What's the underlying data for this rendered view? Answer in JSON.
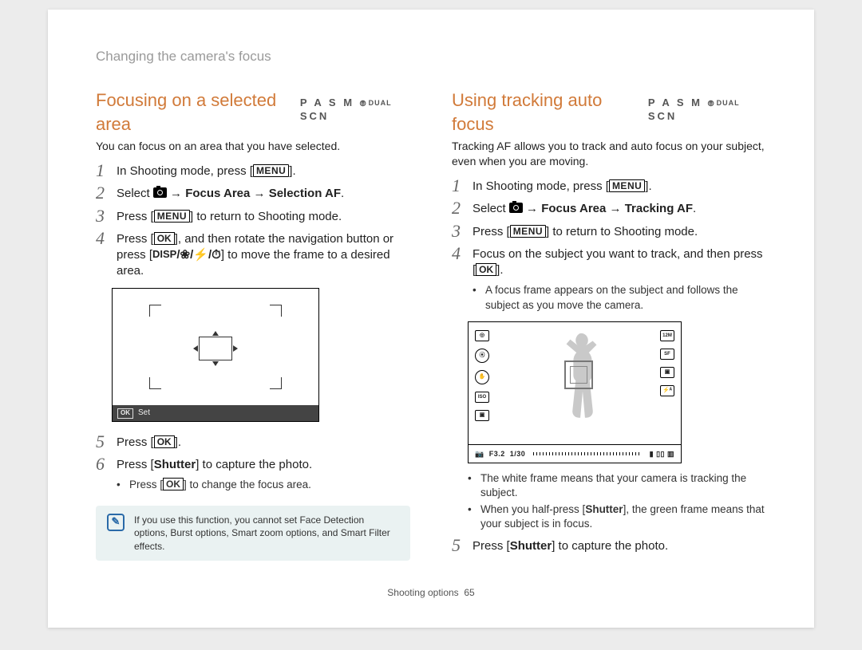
{
  "running_head": "Changing the camera's focus",
  "footer": {
    "section": "Shooting options",
    "page": "65"
  },
  "left": {
    "title": "Focusing on a selected area",
    "modes": "P A S M",
    "modes_suffix": "SCN",
    "dual": "DUAL",
    "intro": "You can focus on an area that you have selected.",
    "step1_a": "In Shooting mode, press [",
    "menu_label": "MENU",
    "step1_b": "].",
    "step2_a": "Select ",
    "step2_b": " → ",
    "step2_focus": "Focus Area",
    "step2_c": " → ",
    "step2_sel": "Selection AF",
    "step2_d": ".",
    "step3_a": "Press [",
    "step3_b": "] to return to Shooting mode.",
    "step4_a": "Press [",
    "ok_label": "OK",
    "step4_b": "], and then rotate the navigation button or press [",
    "disp_label": "DISP",
    "step4_sep": "/",
    "flower": "❀",
    "bolt": "⚡",
    "timer": "⏱",
    "step4_c": "] to move the frame to a desired area.",
    "illus_ok": "OK",
    "illus_set": "Set",
    "step5_a": "Press [",
    "step5_b": "].",
    "step6_a": "Press [",
    "shutter": "Shutter",
    "step6_b": "] to capture the photo.",
    "sub1_a": "Press [",
    "sub1_b": "] to change the focus area.",
    "note": "If you use this function, you cannot set Face Detection options, Burst options, Smart zoom options, and Smart Filter effects."
  },
  "right": {
    "title": "Using tracking auto focus",
    "modes": "P A S M",
    "modes_suffix": "SCN",
    "dual": "DUAL",
    "intro": "Tracking AF allows you to track and auto focus on your subject, even when you are moving.",
    "step1_a": "In Shooting mode, press [",
    "menu_label": "MENU",
    "step1_b": "].",
    "step2_a": "Select ",
    "step2_b": " → ",
    "step2_focus": "Focus Area",
    "step2_c": " → ",
    "step2_track": "Tracking AF",
    "step2_d": ".",
    "step3_a": "Press [",
    "step3_b": "] to return to Shooting mode.",
    "step4_a": "Focus on the subject you want to track, and then press [",
    "ok_label": "OK",
    "step4_b": "].",
    "sub_af": "A focus frame appears on the subject and follows the subject as you move the camera.",
    "illus": {
      "aperture": "F3.2",
      "shutter": "1/30"
    },
    "bul1": "The white frame means that your camera is tracking the subject.",
    "bul2_a": "When you half-press [",
    "shutter": "Shutter",
    "bul2_b": "], the green frame means that your subject is in focus.",
    "step5_a": "Press [",
    "step5_b": "] to capture the photo."
  }
}
